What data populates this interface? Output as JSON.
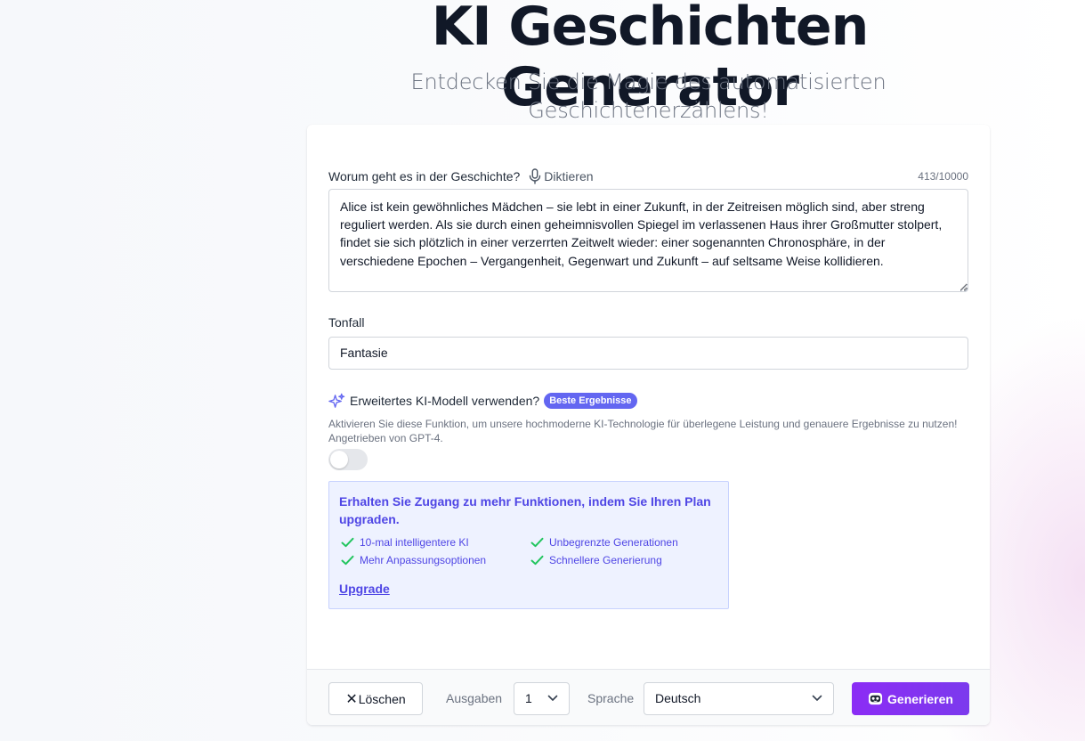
{
  "header": {
    "title": "KI Geschichten Generator",
    "subtitle": "Entdecken Sie die Magie des automatisierten Geschichtenerzählens!"
  },
  "story": {
    "label": "Worum geht es in der Geschichte?",
    "dictate_label": "Diktieren",
    "char_count": "413/10000",
    "value": "Alice ist kein gewöhnliches Mädchen – sie lebt in einer Zukunft, in der Zeitreisen möglich sind, aber streng reguliert werden. Als sie durch einen geheimnisvollen Spiegel im verlassenen Haus ihrer Großmutter stolpert, findet sie sich plötzlich in einer verzerrten Zeitwelt wieder: einer sogenannten Chronosphäre, in der verschiedene Epochen – Vergangenheit, Gegenwart und Zukunft – auf seltsame Weise kollidieren."
  },
  "tone": {
    "label": "Tonfall",
    "value": "Fantasie"
  },
  "advanced": {
    "label": "Erweitertes KI-Modell verwenden?",
    "badge": "Beste Ergebnisse",
    "description": "Aktivieren Sie diese Funktion, um unsere hochmoderne KI-Technologie für überlegene Leistung und genauere Ergebnisse zu nutzen! Angetrieben von GPT-4.",
    "enabled": false
  },
  "upgrade": {
    "title": "Erhalten Sie Zugang zu mehr Funktionen, indem Sie Ihren Plan upgraden.",
    "features": [
      "10-mal intelligentere KI",
      "Unbegrenzte Generationen",
      "Mehr Anpassungsoptionen",
      "Schnellere Generierung"
    ],
    "link_label": "Upgrade"
  },
  "footer": {
    "clear_label": "Löschen",
    "outputs_label": "Ausgaben",
    "outputs_value": "1",
    "language_label": "Sprache",
    "language_value": "Deutsch",
    "generate_label": "Generieren"
  },
  "colors": {
    "accent": "#6366f1",
    "generate_button": "#7c3aed",
    "check": "#22c55e"
  },
  "icons": {
    "dictate": "microphone-icon",
    "advanced": "sparkles-icon",
    "feature": "check-icon",
    "clear": "close-icon",
    "select": "chevron-down-icon",
    "generate": "robot-icon"
  }
}
